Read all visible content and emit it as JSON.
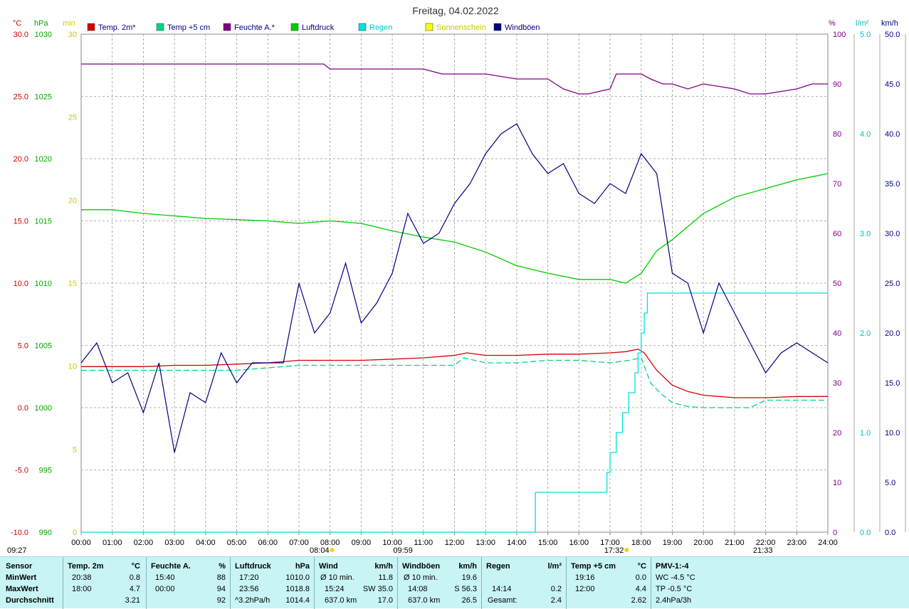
{
  "title": "Freitag, 04.02.2022",
  "legend": [
    {
      "label": "Temp. 2m*",
      "color": "#d40000"
    },
    {
      "label": "Temp +5 cm",
      "color": "#00d38c"
    },
    {
      "label": "Feuchte A.*",
      "color": "#800080"
    },
    {
      "label": "Luftdruck",
      "color": "#00cc00"
    },
    {
      "label": "Regen",
      "color": "#00e0e0"
    },
    {
      "label": "Sonnenschein",
      "color": "#ffff00"
    },
    {
      "label": "Windböen",
      "color": "#000080"
    }
  ],
  "axis_units": {
    "temp": "°C",
    "pressure": "hPa",
    "sun": "min",
    "humidity": "%",
    "rain": "l/m²",
    "wind": "km/h"
  },
  "axis_ticks": {
    "temp": [
      "30.0",
      "25.0",
      "20.0",
      "15.0",
      "10.0",
      "5.0",
      "0.0",
      "-5.0",
      "-10.0"
    ],
    "pressure": [
      "1030",
      "1025",
      "1020",
      "1015",
      "1010",
      "1005",
      "1000",
      "995",
      "990"
    ],
    "sun": [
      "30",
      "25",
      "20",
      "15",
      "10",
      "5",
      "0"
    ],
    "humidity": [
      "100",
      "90",
      "80",
      "70",
      "60",
      "50",
      "40",
      "30",
      "20",
      "10",
      "0"
    ],
    "rain": [
      "5.0",
      "4.0",
      "3.0",
      "2.0",
      "1.0",
      "0.0"
    ],
    "wind": [
      "50.0",
      "45.0",
      "40.0",
      "35.0",
      "30.0",
      "25.0",
      "20.0",
      "15.0",
      "10.0",
      "5.0",
      "0.0"
    ]
  },
  "time_labels": [
    "00:00",
    "01:00",
    "02:00",
    "03:00",
    "04:00",
    "05:00",
    "06:00",
    "07:00",
    "08:00",
    "09:00",
    "10:00",
    "11:00",
    "12:00",
    "13:00",
    "14:00",
    "15:00",
    "16:00",
    "17:00",
    "18:00",
    "19:00",
    "20:00",
    "21:00",
    "22:00",
    "23:00",
    "24:00"
  ],
  "sun_events": {
    "sunrise": "08:04",
    "sunset": "17:32",
    "moonrise": "09:27",
    "moon_a": "09:59",
    "moon_b": "21:33"
  },
  "chart_data": {
    "type": "line",
    "title": "Freitag, 04.02.2022",
    "x_unit": "hours",
    "xlim": [
      0,
      24
    ],
    "grid": true,
    "legend_position": "top",
    "axes": {
      "temp": {
        "ylim": [
          -10,
          30
        ]
      },
      "pressure": {
        "ylim": [
          990,
          1030
        ]
      },
      "sun": {
        "ylim": [
          0,
          30
        ]
      },
      "humidity": {
        "ylim": [
          0,
          100
        ]
      },
      "rain": {
        "ylim": [
          0,
          5
        ]
      },
      "wind": {
        "ylim": [
          0,
          50
        ]
      }
    },
    "series": [
      {
        "name": "Temp. 2m*",
        "axis": "temp",
        "color": "#d40000",
        "x": [
          0,
          1,
          2,
          3,
          4,
          5,
          6,
          7,
          8,
          9,
          10,
          11,
          12,
          12.4,
          13,
          14,
          15,
          16,
          17,
          17.5,
          17.9,
          18.1,
          18.5,
          19,
          19.5,
          20,
          21,
          22,
          23,
          24
        ],
        "y": [
          3.3,
          3.3,
          3.3,
          3.4,
          3.4,
          3.5,
          3.6,
          3.8,
          3.8,
          3.8,
          3.9,
          4.0,
          4.2,
          4.4,
          4.2,
          4.2,
          4.3,
          4.3,
          4.4,
          4.5,
          4.7,
          4.4,
          3.0,
          1.8,
          1.3,
          1.0,
          0.8,
          0.8,
          0.9,
          0.9
        ]
      },
      {
        "name": "Temp +5 cm",
        "axis": "temp",
        "color": "#00d38c",
        "x": [
          0,
          1,
          2,
          3,
          4,
          5,
          6,
          7,
          8,
          9,
          10,
          11,
          12,
          12.3,
          13,
          14,
          15,
          16,
          17,
          17.6,
          18,
          18.3,
          18.6,
          19,
          19.5,
          20,
          21,
          21.5,
          22,
          23,
          24
        ],
        "y": [
          3.0,
          3.0,
          3.0,
          3.0,
          3.0,
          3.0,
          3.2,
          3.4,
          3.4,
          3.4,
          3.4,
          3.4,
          3.4,
          4.0,
          3.6,
          3.6,
          3.8,
          3.8,
          3.6,
          3.8,
          4.0,
          2.0,
          1.2,
          0.4,
          0.1,
          0.0,
          0.0,
          0.0,
          0.6,
          0.6,
          0.6
        ]
      },
      {
        "name": "Feuchte A.*",
        "axis": "humidity",
        "color": "#800080",
        "x": [
          0,
          1,
          2,
          3,
          4,
          5,
          6,
          7,
          7.8,
          8,
          9,
          10,
          11,
          11.6,
          12,
          13,
          14,
          15,
          15.5,
          16,
          16.3,
          17,
          17.2,
          18,
          18.3,
          18.7,
          19,
          19.5,
          20,
          21,
          21.5,
          22,
          23,
          23.5,
          24
        ],
        "y": [
          94,
          94,
          94,
          94,
          94,
          94,
          94,
          94,
          94,
          93,
          93,
          93,
          93,
          92,
          92,
          92,
          91,
          91,
          89,
          88,
          88,
          89,
          92,
          92,
          91,
          90,
          90,
          89,
          90,
          89,
          88,
          88,
          89,
          90,
          90
        ]
      },
      {
        "name": "Luftdruck",
        "axis": "pressure",
        "color": "#00cc00",
        "x": [
          0,
          1,
          2,
          3,
          4,
          5,
          6,
          7,
          8,
          9,
          10,
          11,
          12,
          13,
          14,
          15,
          16,
          17,
          17.5,
          18,
          18.5,
          19,
          20,
          21,
          22,
          23,
          24
        ],
        "y": [
          1015.9,
          1015.9,
          1015.6,
          1015.4,
          1015.2,
          1015.1,
          1015.0,
          1014.8,
          1015.0,
          1014.8,
          1014.2,
          1013.7,
          1013.3,
          1012.5,
          1011.4,
          1010.8,
          1010.3,
          1010.3,
          1010.0,
          1010.8,
          1012.6,
          1013.5,
          1015.6,
          1016.9,
          1017.6,
          1018.3,
          1018.8
        ]
      },
      {
        "name": "Regen",
        "axis": "rain",
        "color": "#00e0e0",
        "x": [
          0,
          14.2,
          14.6,
          16.6,
          16.9,
          17.0,
          17.2,
          17.4,
          17.6,
          17.8,
          17.9,
          18.0,
          18.1,
          18.2,
          24
        ],
        "y": [
          0,
          0,
          0.4,
          0.4,
          0.6,
          0.8,
          1.0,
          1.2,
          1.4,
          1.6,
          1.8,
          2.0,
          2.2,
          2.4,
          2.4
        ]
      },
      {
        "name": "Windböen",
        "axis": "wind",
        "color": "#000080",
        "x": [
          0,
          0.5,
          1,
          1.5,
          2,
          2.5,
          3,
          3.5,
          4,
          4.5,
          5,
          5.5,
          6,
          6.5,
          7,
          7.5,
          8,
          8.5,
          9,
          9.5,
          10,
          10.5,
          11,
          11.5,
          12,
          12.5,
          13,
          13.5,
          14,
          14.5,
          15,
          15.5,
          16,
          16.5,
          17,
          17.5,
          18,
          18.5,
          19,
          19.5,
          20,
          20.5,
          21,
          21.5,
          22,
          22.5,
          23,
          23.5,
          24
        ],
        "y": [
          17,
          19,
          15,
          16,
          12,
          17,
          8,
          14,
          13,
          18,
          15,
          17,
          17,
          17,
          25,
          20,
          22,
          27,
          21,
          23,
          26,
          32,
          29,
          30,
          33,
          35,
          38,
          40,
          41,
          38,
          36,
          37,
          34,
          33,
          35,
          34,
          38,
          36,
          26,
          25,
          20,
          25,
          22,
          19,
          16,
          18,
          19,
          18,
          17
        ]
      }
    ]
  },
  "stats": {
    "sensor": {
      "title": "Sensor",
      "rows": [
        "MinWert",
        "MaxWert",
        "Durchschnitt"
      ]
    },
    "temp2m": {
      "title": "Temp. 2m",
      "unit": "°C",
      "min_time": "20:38",
      "min": "0.8",
      "max_time": "18:00",
      "max": "4.7",
      "avg": "3.21"
    },
    "humidity": {
      "title": "Feuchte A.",
      "unit": "%",
      "min_time": "15:40",
      "min": "88",
      "max_time": "00:00",
      "max": "94",
      "avg": "92"
    },
    "pressure": {
      "title": "Luftdruck",
      "unit": "hPa",
      "min_time": "17:20",
      "min": "1010.0",
      "max_time": "23:56",
      "max": "1018.8",
      "trend": "^3.2hPa/h",
      "avg": "1014.4"
    },
    "wind": {
      "title": "Wind",
      "unit": "km/h",
      "r1_label": "Ø 10 min.",
      "r1": "11.8",
      "r2_time": "15:24",
      "r2_dir": "SW 35.0",
      "r3_label": "637.0 km",
      "r3": "17.0"
    },
    "gusts": {
      "title": "Windböen",
      "unit": "km/h",
      "r1_label": "Ø 10 min.",
      "r1": "19.6",
      "r2_time": "14:08",
      "r2_dir": "S 56.3",
      "r3_label": "637.0 km",
      "r3": "26.5"
    },
    "rain": {
      "title": "Regen",
      "unit": "l/m²",
      "r2_time": "14:14",
      "r2": "0.2",
      "r3_label": "Gesamt:",
      "r3": "2.4"
    },
    "temp5": {
      "title": "Temp +5 cm",
      "unit": "°C",
      "min_time": "19:16",
      "min": "0.0",
      "max_time": "12:00",
      "max": "4.4",
      "avg": "2.62"
    },
    "pmv": {
      "title": "PMV-1:-4",
      "wc": "WC -4.5 °C",
      "tp": "TP -0.5 °C",
      "tr": "2.4hPa/3h"
    }
  }
}
